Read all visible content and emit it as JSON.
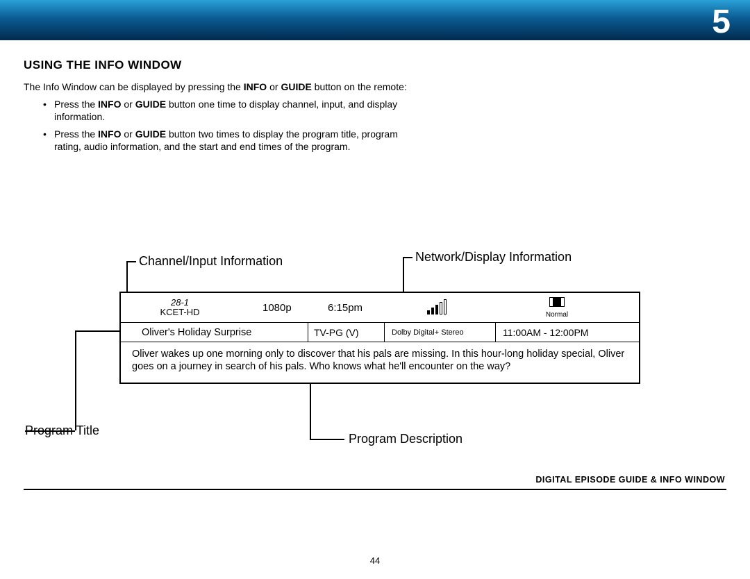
{
  "page_number_large": "5",
  "heading": "USING THE INFO WINDOW",
  "intro_pre": "The Info Window can be displayed by pressing the ",
  "intro_b1": "INFO",
  "intro_mid": " or ",
  "intro_b2": "GUIDE",
  "intro_post": " button on the remote:",
  "bullet1_pre": "Press the ",
  "bullet1_b1": "INFO",
  "bullet1_mid": " or ",
  "bullet1_b2": "GUIDE",
  "bullet1_post": " button one time to display channel, input, and display information.",
  "bullet2_pre": "Press the ",
  "bullet2_b1": "INFO",
  "bullet2_mid": " or ",
  "bullet2_b2": "GUIDE",
  "bullet2_post": " button two times to display the program title, program rating, audio information, and the start and end times of the program.",
  "callouts": {
    "channel_input": "Channel/Input Information",
    "network_display": "Network/Display Information",
    "program_title": "Program Title",
    "program_description": "Program Description"
  },
  "info": {
    "channel_number": "28-1",
    "channel_name": "KCET-HD",
    "resolution": "1080p",
    "clock": "6:15pm",
    "aspect_label": "Normal",
    "program_title": "Oliver's Holiday Surprise",
    "rating": "TV-PG (V)",
    "audio": "Dolby Digital+ Stereo",
    "timespan": "11:00AM - 12:00PM",
    "description": "Oliver wakes up one morning only to discover that his pals are missing. In this hour-long holiday special, Oliver goes on a journey in search of his pals. Who knows what he'll encounter on the way?"
  },
  "footer_label": "DIGITAL EPISODE GUIDE & INFO WINDOW",
  "page_num_bottom": "44"
}
